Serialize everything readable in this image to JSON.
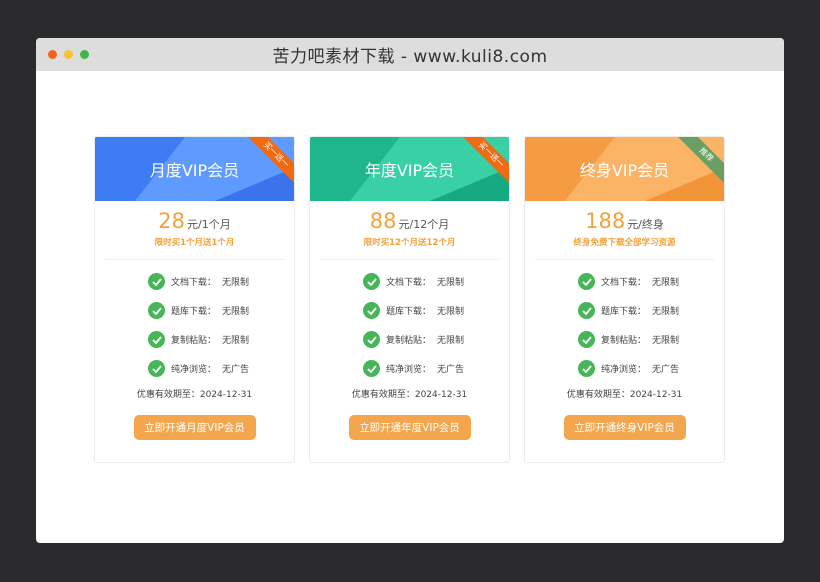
{
  "window": {
    "title": "苦力吧素材下载 - www.kuli8.com",
    "dots": [
      "#f0641c",
      "#f6c233",
      "#40b54b"
    ]
  },
  "cards": [
    {
      "title": "月度VIP会员",
      "ribbon": "买一送一",
      "ribbon_color": "#f06a12",
      "head_colors": [
        "#4d8bfb",
        "#3e7cf3",
        "#5f9bff",
        "#3a73ea"
      ],
      "price": "28",
      "unit": "元/1个月",
      "promo": "限时买1个月送1个月",
      "features": [
        {
          "label": "文档下载：",
          "value": "无限制"
        },
        {
          "label": "题库下载：",
          "value": "无限制"
        },
        {
          "label": "复制粘贴：",
          "value": "无限制"
        },
        {
          "label": "纯净浏览：",
          "value": "无广告"
        }
      ],
      "expiry": "优惠有效期至：2024-12-31",
      "cta": "立即开通月度VIP会员"
    },
    {
      "title": "年度VIP会员",
      "ribbon": "买一送一",
      "ribbon_color": "#f06a12",
      "head_colors": [
        "#2cc59a",
        "#20b68c",
        "#3ad0a6",
        "#17a982"
      ],
      "price": "88",
      "unit": "元/12个月",
      "promo": "限时买12个月送12个月",
      "features": [
        {
          "label": "文档下载：",
          "value": "无限制"
        },
        {
          "label": "题库下载：",
          "value": "无限制"
        },
        {
          "label": "复制粘贴：",
          "value": "无限制"
        },
        {
          "label": "纯净浏览：",
          "value": "无广告"
        }
      ],
      "expiry": "优惠有效期至：2024-12-31",
      "cta": "立即开通年度VIP会员"
    },
    {
      "title": "终身VIP会员",
      "ribbon": "推荐",
      "ribbon_color": "#6b9e63",
      "head_colors": [
        "#f9a753",
        "#f59c43",
        "#fbb466",
        "#f29539"
      ],
      "price": "188",
      "unit": "元/终身",
      "promo": "终身免费下载全部学习资源",
      "features": [
        {
          "label": "文档下载：",
          "value": "无限制"
        },
        {
          "label": "题库下载：",
          "value": "无限制"
        },
        {
          "label": "复制粘贴：",
          "value": "无限制"
        },
        {
          "label": "纯净浏览：",
          "value": "无广告"
        }
      ],
      "expiry": "优惠有效期至：2024-12-31",
      "cta": "立即开通终身VIP会员"
    }
  ]
}
